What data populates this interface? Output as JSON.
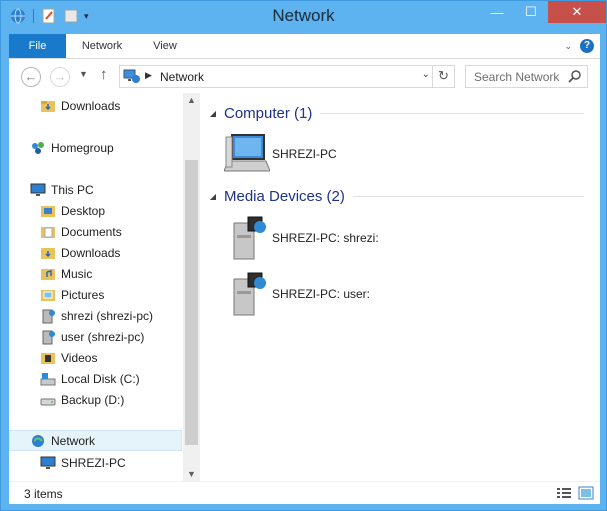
{
  "window": {
    "title": "Network",
    "controls": {
      "minimize": "—",
      "maximize": "☐",
      "close": "✕"
    }
  },
  "ribbon": {
    "tabs": [
      {
        "label": "File",
        "active": true
      },
      {
        "label": "Network",
        "active": false
      },
      {
        "label": "View",
        "active": false
      }
    ],
    "help": "?"
  },
  "address_bar": {
    "path": "Network",
    "search_placeholder": "Search Network"
  },
  "nav_pane": {
    "items": [
      {
        "label": "Downloads",
        "icon": "folder-download-icon"
      },
      {
        "label": "Homegroup",
        "icon": "homegroup-icon"
      },
      {
        "label": "This PC",
        "icon": "computer-icon"
      },
      {
        "label": "Desktop",
        "icon": "folder-icon"
      },
      {
        "label": "Documents",
        "icon": "folder-icon"
      },
      {
        "label": "Downloads",
        "icon": "folder-download-icon"
      },
      {
        "label": "Music",
        "icon": "folder-music-icon"
      },
      {
        "label": "Pictures",
        "icon": "folder-pictures-icon"
      },
      {
        "label": "shrezi (shrezi-pc)",
        "icon": "media-server-icon"
      },
      {
        "label": "user (shrezi-pc)",
        "icon": "media-server-icon"
      },
      {
        "label": "Videos",
        "icon": "folder-videos-icon"
      },
      {
        "label": "Local Disk (C:)",
        "icon": "drive-icon"
      },
      {
        "label": "Backup (D:)",
        "icon": "drive-icon"
      },
      {
        "label": "Network",
        "icon": "network-icon",
        "selected": true
      },
      {
        "label": "SHREZI-PC",
        "icon": "computer-icon"
      }
    ]
  },
  "content": {
    "groups": [
      {
        "title": "Computer (1)",
        "items": [
          {
            "label": "SHREZI-PC",
            "icon": "computer-icon"
          }
        ]
      },
      {
        "title": "Media Devices (2)",
        "items": [
          {
            "label": "SHREZI-PC: shrezi:",
            "icon": "media-device-icon"
          },
          {
            "label": "SHREZI-PC: user:",
            "icon": "media-device-icon"
          }
        ]
      }
    ]
  },
  "status_bar": {
    "count": "3 items"
  },
  "colors": {
    "accent": "#1979ca",
    "title_bar": "#5db2f0",
    "close": "#c7504b",
    "group_title": "#1e3287"
  }
}
